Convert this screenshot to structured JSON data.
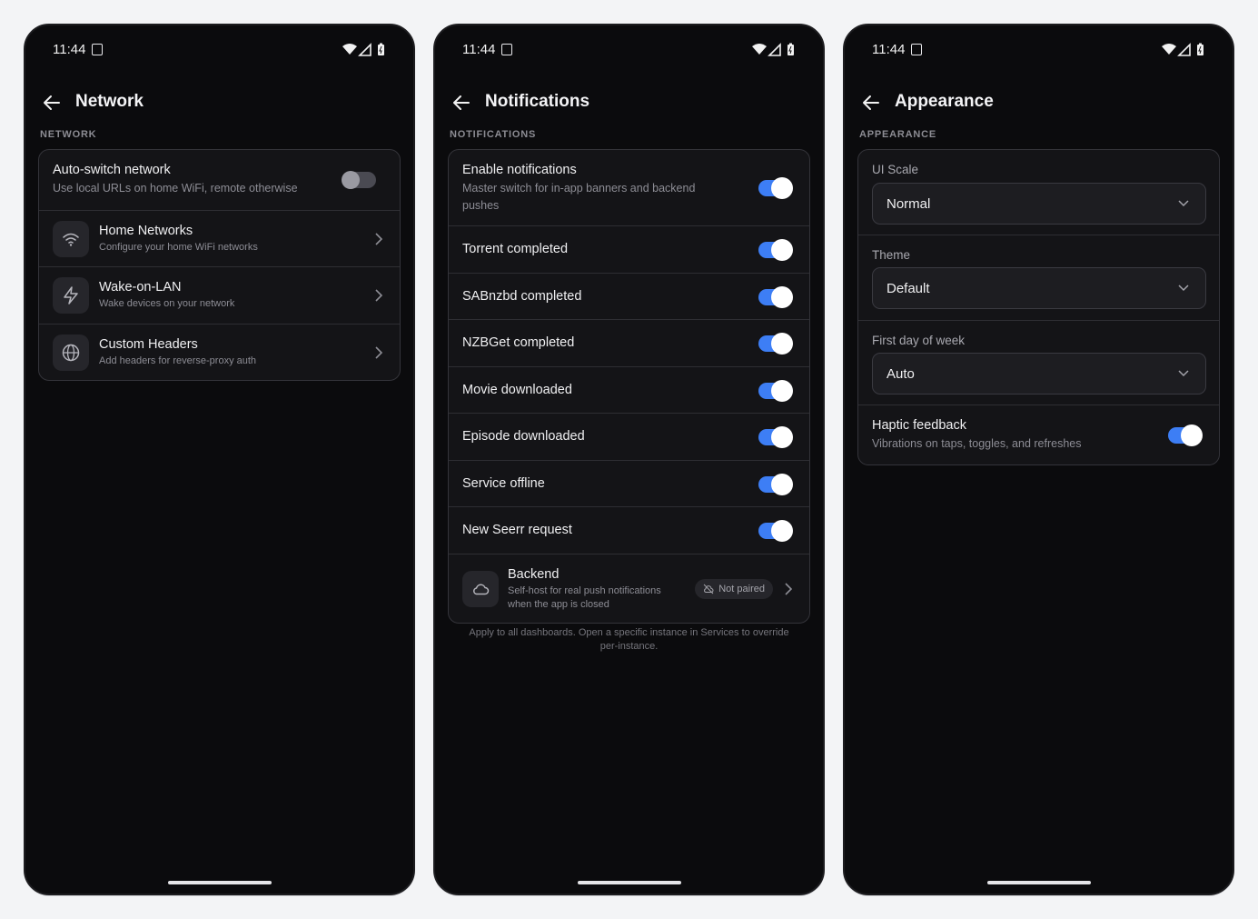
{
  "status_bar": {
    "time": "11:44"
  },
  "network_screen": {
    "title": "Network",
    "section": "NETWORK",
    "auto_switch": {
      "title": "Auto-switch network",
      "subtitle": "Use local URLs on home WiFi, remote otherwise",
      "enabled": false
    },
    "items": [
      {
        "title": "Home Networks",
        "subtitle": "Configure your home WiFi networks",
        "icon": "wifi-icon"
      },
      {
        "title": "Wake-on-LAN",
        "subtitle": "Wake devices on your network",
        "icon": "lightning-icon"
      },
      {
        "title": "Custom Headers",
        "subtitle": "Add headers for reverse-proxy auth",
        "icon": "globe-icon"
      }
    ]
  },
  "notifications_screen": {
    "title": "Notifications",
    "section": "NOTIFICATIONS",
    "enable": {
      "title": "Enable notifications",
      "subtitle": "Master switch for in-app banners and backend pushes",
      "enabled": true
    },
    "toggles": [
      {
        "label": "Torrent completed",
        "enabled": true
      },
      {
        "label": "SABnzbd completed",
        "enabled": true
      },
      {
        "label": "NZBGet completed",
        "enabled": true
      },
      {
        "label": "Movie downloaded",
        "enabled": true
      },
      {
        "label": "Episode downloaded",
        "enabled": true
      },
      {
        "label": "Service offline",
        "enabled": true
      },
      {
        "label": "New Seerr request",
        "enabled": true
      }
    ],
    "backend": {
      "title": "Backend",
      "subtitle": "Self-host for real push notifications when the app is closed",
      "status": "Not paired",
      "icon": "cloud-icon"
    },
    "footnote": "Apply to all dashboards. Open a specific instance in Services to override per-instance."
  },
  "appearance_screen": {
    "title": "Appearance",
    "section": "APPEARANCE",
    "ui_scale": {
      "label": "UI Scale",
      "value": "Normal"
    },
    "theme": {
      "label": "Theme",
      "value": "Default"
    },
    "first_day": {
      "label": "First day of week",
      "value": "Auto"
    },
    "haptic": {
      "title": "Haptic feedback",
      "subtitle": "Vibrations on taps, toggles, and refreshes",
      "enabled": true
    }
  },
  "colors": {
    "accent": "#3d7ef5",
    "background": "#0b0b0d",
    "card": "#141417",
    "page": "#f3f4f6"
  }
}
